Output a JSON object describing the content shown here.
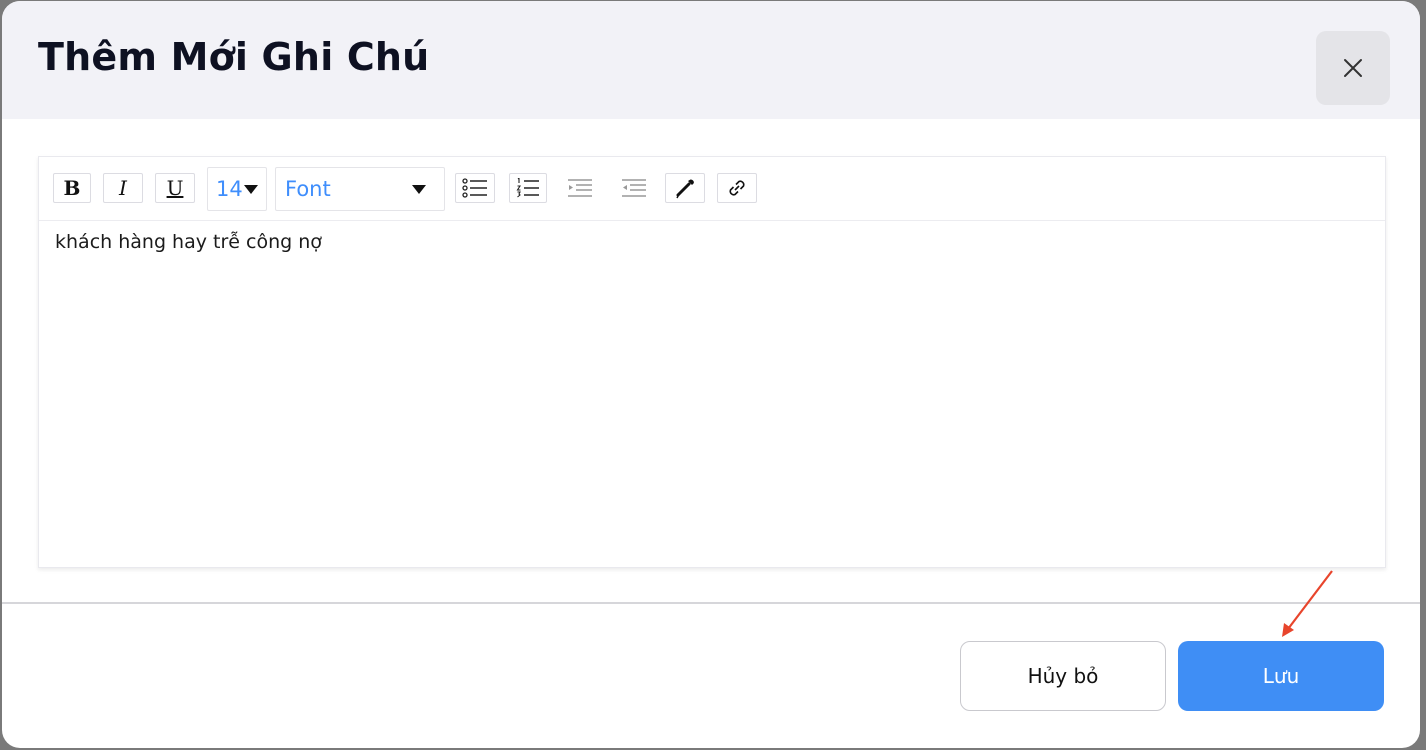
{
  "modal": {
    "title": "Thêm Mới Ghi Chú",
    "close_icon": "close-icon"
  },
  "toolbar": {
    "bold_label": "B",
    "italic_label": "I",
    "underline_label": "U",
    "font_size_value": "14",
    "font_family_value": "Font",
    "icons": [
      "bullet-list-icon",
      "numbered-list-icon",
      "indent-icon",
      "outdent-icon",
      "text-color-icon",
      "link-icon"
    ]
  },
  "editor": {
    "content": "khách hàng hay trễ công nợ"
  },
  "footer": {
    "cancel_label": "Hủy bỏ",
    "save_label": "Lưu"
  },
  "colors": {
    "primary": "#3f8ef5",
    "header_bg": "#f2f2f7",
    "annotation": "#e8452c"
  }
}
